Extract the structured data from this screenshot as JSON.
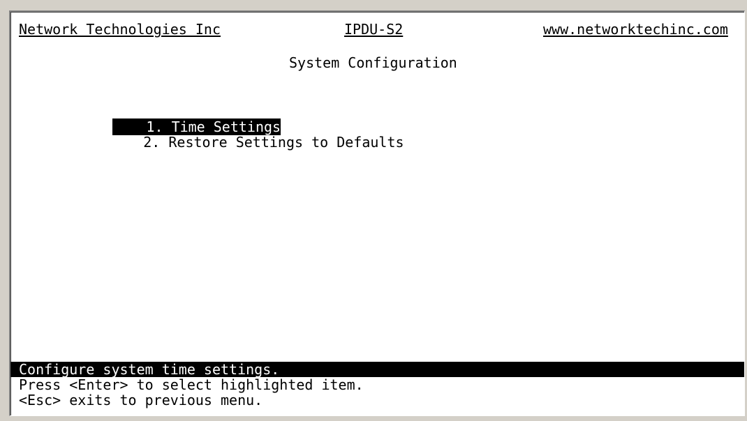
{
  "header": {
    "company": "Network Technologies Inc",
    "product": "IPDU-S2",
    "website": "www.networktechinc.com"
  },
  "title": "System Configuration",
  "menu": {
    "items": [
      {
        "number": "1.",
        "label": "Time Settings",
        "selected": true
      },
      {
        "number": "2.",
        "label": "Restore Settings to Defaults",
        "selected": false
      }
    ]
  },
  "footer": {
    "description": "Configure system time settings.",
    "hint_enter": "Press <Enter> to select highlighted item.",
    "hint_esc": "<Esc> exits to previous menu."
  },
  "colors": {
    "background": "#ffffff",
    "text": "#000000",
    "highlight_bg": "#000000",
    "highlight_fg": "#ffffff",
    "window_chrome": "#d4d0c8"
  }
}
